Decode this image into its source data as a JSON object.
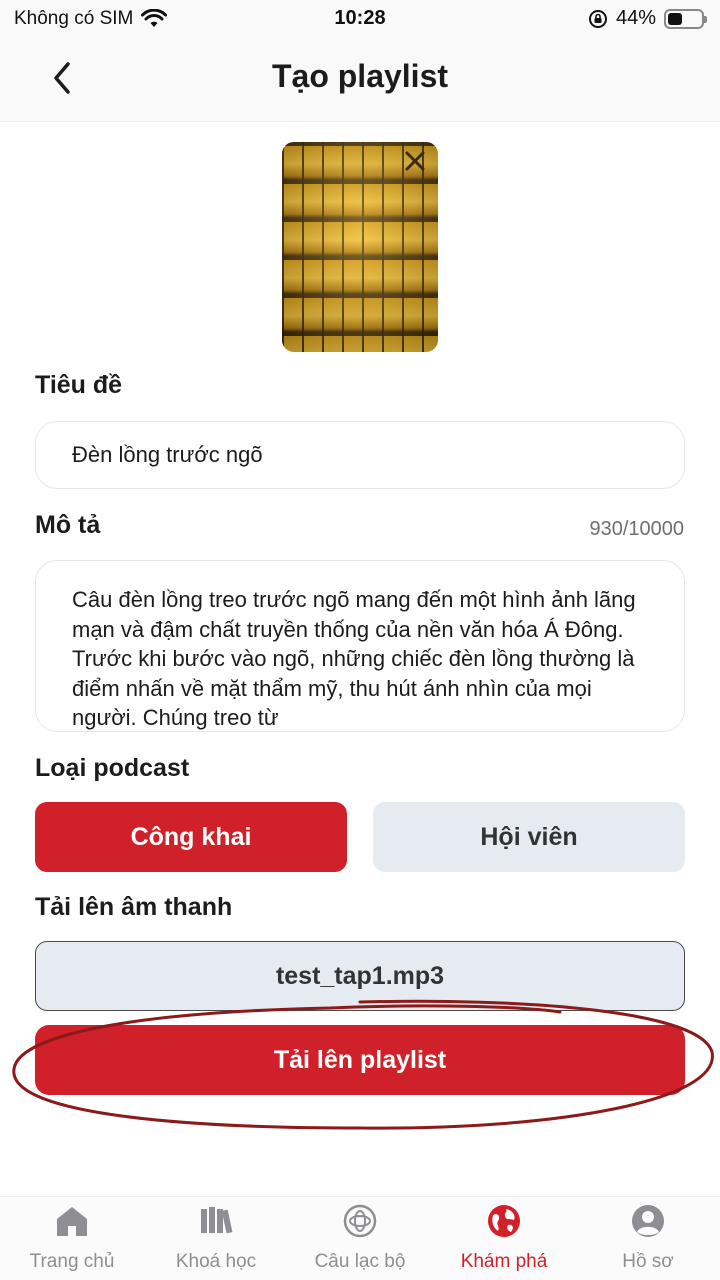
{
  "status_bar": {
    "carrier": "Không có SIM",
    "time": "10:28",
    "battery_percent": "44%",
    "battery_level": 0.44,
    "icons": [
      "wifi-icon",
      "orientation-lock-icon",
      "battery-icon"
    ]
  },
  "header": {
    "title": "Tạo playlist",
    "back_icon": "chevron-left-icon"
  },
  "cover": {
    "remove_icon": "close-icon"
  },
  "form": {
    "title_label": "Tiêu đề",
    "title_value": "Đèn lồng trước ngõ",
    "description_label": "Mô tả",
    "description_counter": "930/10000",
    "description_value": "Câu đèn lồng treo trước ngõ mang đến một hình ảnh lãng mạn và đậm chất truyền thống của nền văn hóa Á Đông. Trước khi bước vào ngõ, những chiếc đèn lồng thường là điểm nhấn về mặt thẩm mỹ, thu hút ánh nhìn của mọi người. Chúng treo từ",
    "podcast_type_label": "Loại podcast",
    "podcast_type_options": [
      "Công khai",
      "Hội viên"
    ],
    "podcast_type_selected": "Công khai",
    "audio_label": "Tải lên âm thanh",
    "audio_file": "test_tap1.mp3",
    "submit_label": "Tải lên playlist"
  },
  "tabbar": {
    "items": [
      {
        "label": "Trang chủ",
        "icon": "home-icon"
      },
      {
        "label": "Khoá học",
        "icon": "books-icon"
      },
      {
        "label": "Câu lạc bộ",
        "icon": "club-icon"
      },
      {
        "label": "Khám phá",
        "icon": "globe-icon"
      },
      {
        "label": "Hồ sơ",
        "icon": "profile-icon"
      }
    ],
    "active": "Khám phá"
  },
  "colors": {
    "accent": "#d0202a",
    "secondary_button": "#e6ebf2",
    "annotation": "#8b1a1a",
    "inactive_tab": "#8e8e93"
  }
}
